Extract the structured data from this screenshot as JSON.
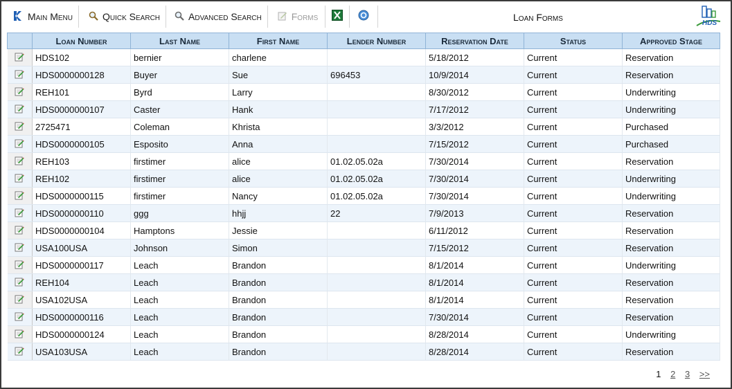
{
  "toolbar": {
    "main_menu": "Main Menu",
    "quick_search": "Quick Search",
    "advanced_search": "Advanced Search",
    "forms": "Forms"
  },
  "title": "Loan Forms",
  "logo_text": "HDS",
  "table": {
    "headers": [
      "Loan Number",
      "Last Name",
      "First Name",
      "Lender Number",
      "Reservation Date",
      "Status",
      "Approved Stage"
    ],
    "rows": [
      [
        "HDS102",
        "bernier",
        "charlene",
        "",
        "5/18/2012",
        "Current",
        "Reservation"
      ],
      [
        "HDS0000000128",
        "Buyer",
        "Sue",
        "696453",
        "10/9/2014",
        "Current",
        "Reservation"
      ],
      [
        "REH101",
        "Byrd",
        "Larry",
        "",
        "8/30/2012",
        "Current",
        "Underwriting"
      ],
      [
        "HDS0000000107",
        "Caster",
        "Hank",
        "",
        "7/17/2012",
        "Current",
        "Underwriting"
      ],
      [
        "2725471",
        "Coleman",
        "Khrista",
        "",
        "3/3/2012",
        "Current",
        "Purchased"
      ],
      [
        "HDS0000000105",
        "Esposito",
        "Anna",
        "",
        "7/15/2012",
        "Current",
        "Purchased"
      ],
      [
        "REH103",
        "firstimer",
        "alice",
        "01.02.05.02a",
        "7/30/2014",
        "Current",
        "Reservation"
      ],
      [
        "REH102",
        "firstimer",
        "alice",
        "01.02.05.02a",
        "7/30/2014",
        "Current",
        "Underwriting"
      ],
      [
        "HDS0000000115",
        "firstimer",
        "Nancy",
        "01.02.05.02a",
        "7/30/2014",
        "Current",
        "Underwriting"
      ],
      [
        "HDS0000000110",
        "ggg",
        "hhjj",
        "22",
        "7/9/2013",
        "Current",
        "Reservation"
      ],
      [
        "HDS0000000104",
        "Hamptons",
        "Jessie",
        "",
        "6/11/2012",
        "Current",
        "Reservation"
      ],
      [
        "USA100USA",
        "Johnson",
        "Simon",
        "",
        "7/15/2012",
        "Current",
        "Reservation"
      ],
      [
        "HDS0000000117",
        "Leach",
        "Brandon",
        "",
        "8/1/2014",
        "Current",
        "Underwriting"
      ],
      [
        "REH104",
        "Leach",
        "Brandon",
        "",
        "8/1/2014",
        "Current",
        "Reservation"
      ],
      [
        "USA102USA",
        "Leach",
        "Brandon",
        "",
        "8/1/2014",
        "Current",
        "Reservation"
      ],
      [
        "HDS0000000116",
        "Leach",
        "Brandon",
        "",
        "7/30/2014",
        "Current",
        "Reservation"
      ],
      [
        "HDS0000000124",
        "Leach",
        "Brandon",
        "",
        "8/28/2014",
        "Current",
        "Underwriting"
      ],
      [
        "USA103USA",
        "Leach",
        "Brandon",
        "",
        "8/28/2014",
        "Current",
        "Reservation"
      ]
    ]
  },
  "pager": {
    "pages": [
      "1",
      "2",
      "3"
    ],
    "current": "1",
    "next": ">>"
  }
}
